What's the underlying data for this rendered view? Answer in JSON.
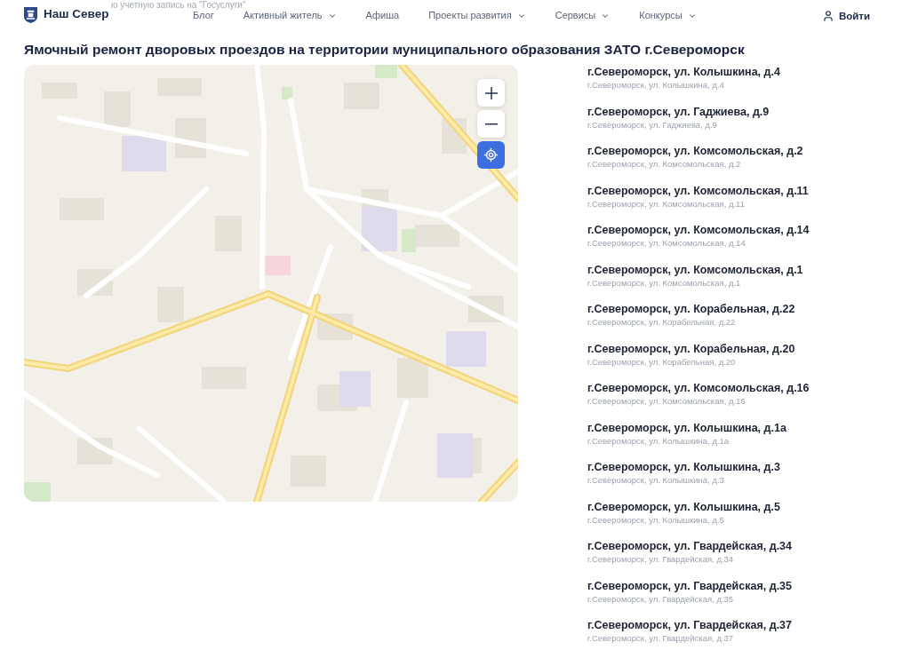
{
  "header": {
    "logo_text": "Наш Север",
    "faded_text": "ю учетную запись на \"Госуслуги\"",
    "nav": [
      {
        "label": "Блог",
        "dropdown": false
      },
      {
        "label": "Активный житель",
        "dropdown": true
      },
      {
        "label": "Афиша",
        "dropdown": false
      },
      {
        "label": "Проекты развития",
        "dropdown": true
      },
      {
        "label": "Сервисы",
        "dropdown": true
      },
      {
        "label": "Конкурсы",
        "dropdown": true
      }
    ],
    "login": "Войти"
  },
  "title": "Ямочный ремонт дворовых проездов на территории муниципального образования ЗАТО г.Североморск",
  "map": {
    "controls": [
      {
        "kind": "zoom_in"
      },
      {
        "kind": "zoom_out"
      },
      {
        "kind": "locate"
      }
    ]
  },
  "addresses": [
    {
      "title": "г.Североморск, ул. Колышкина, д.4",
      "subtitle": "г.Североморск, ул. Колышкина, д.4"
    },
    {
      "title": "г.Североморск, ул. Гаджиева, д.9",
      "subtitle": "г.Североморск, ул. Гаджиева, д.9"
    },
    {
      "title": "г.Североморск, ул. Комсомольская, д.2",
      "subtitle": "г.Североморск, ул. Комсомольская, д.2"
    },
    {
      "title": "г.Североморск, ул. Комсомольская, д.11",
      "subtitle": "г.Североморск, ул. Комсомольская, д.11"
    },
    {
      "title": "г.Североморск, ул. Комсомольская, д.14",
      "subtitle": "г.Североморск, ул. Комсомольская, д.14"
    },
    {
      "title": "г.Североморск, ул. Комсомольская, д.1",
      "subtitle": "г.Североморск, ул. Комсомольская, д.1"
    },
    {
      "title": "г.Североморск, ул. Корабельная, д.22",
      "subtitle": "г.Североморск, ул. Корабельная, д.22"
    },
    {
      "title": "г.Североморск, ул. Корабельная, д.20",
      "subtitle": "г.Североморск, ул. Корабельная, д.20"
    },
    {
      "title": "г.Североморск, ул. Комсомольская, д.16",
      "subtitle": "г.Североморск, ул. Комсомольская, д.16"
    },
    {
      "title": "г.Североморск, ул. Колышкина, д.1а",
      "subtitle": "г.Североморск, ул. Колышкина, д.1а"
    },
    {
      "title": "г.Североморск, ул. Колышкина, д.3",
      "subtitle": "г.Североморск, ул. Колышкина, д.3"
    },
    {
      "title": "г.Североморск, ул. Колышкина, д.5",
      "subtitle": "г.Североморск, ул. Колышкина, д.5"
    },
    {
      "title": "г.Североморск, ул. Гвардейская, д.34",
      "subtitle": "г.Североморск, ул. Гвардейская, д.34"
    },
    {
      "title": "г.Североморск, ул. Гвардейская, д.35",
      "subtitle": "г.Североморск, ул. Гвардейская, д.35"
    },
    {
      "title": "г.Североморск, ул. Гвардейская, д.37",
      "subtitle": "г.Североморск, ул. Гвардейская, д.37"
    }
  ]
}
